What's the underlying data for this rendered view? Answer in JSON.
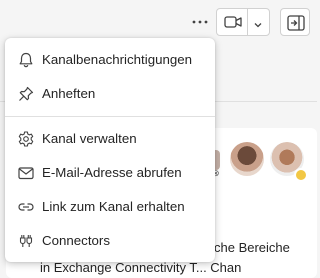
{
  "toolbar": {
    "more_icon": "more-horizontal-icon",
    "video_icon": "video-camera-icon",
    "caret_icon": "chevron-down-icon",
    "panel_icon": "open-panel-icon"
  },
  "menu": {
    "items": [
      {
        "label": "Kanalbenachrichtigungen",
        "icon": "bell-icon"
      },
      {
        "label": "Anheften",
        "icon": "pin-icon"
      },
      {
        "label": "Kanal verwalten",
        "icon": "gear-icon"
      },
      {
        "label": "E-Mail-Adresse abrufen",
        "icon": "mail-icon"
      },
      {
        "label": "Link zum Kanal erhalten",
        "icon": "link-icon"
      },
      {
        "label": "Connectors",
        "icon": "connector-plug-icon"
      }
    ]
  },
  "background": {
    "text_line1": "che Bereiche",
    "text_line2": "in Exchange Connectivity T...    Chan"
  }
}
